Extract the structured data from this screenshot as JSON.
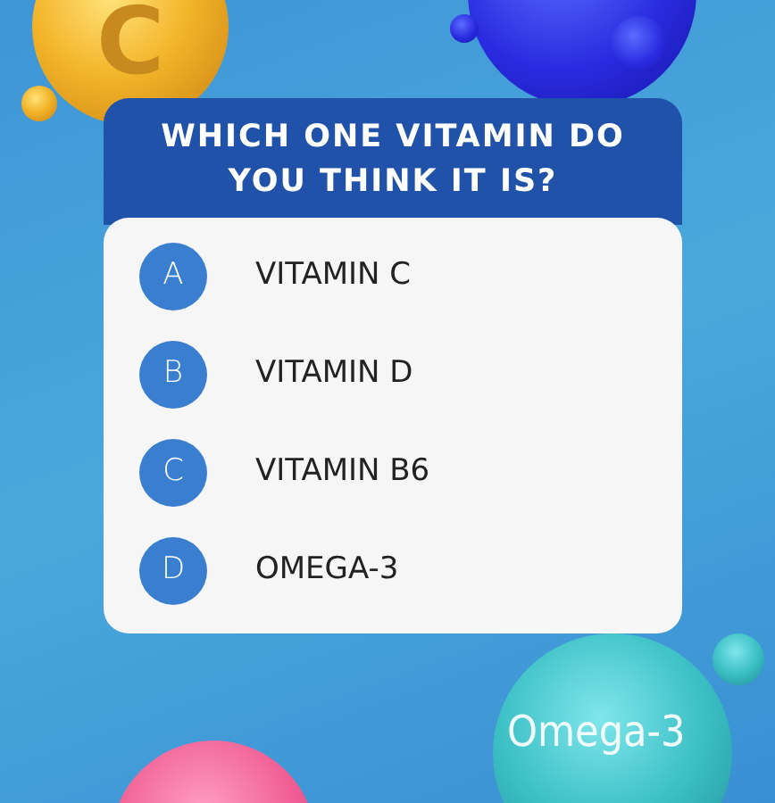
{
  "gold_sphere": {
    "label": "C"
  },
  "question": "WHICH ONE VITAMIN DO YOU THINK IT IS?",
  "options": [
    {
      "letter": "A",
      "text": "VITAMIN C"
    },
    {
      "letter": "B",
      "text": "VITAMIN D"
    },
    {
      "letter": "C",
      "text": "VITAMIN B6"
    },
    {
      "letter": "D",
      "text": "OMEGA-3"
    }
  ],
  "teal_sphere": {
    "label": "Omega-3"
  }
}
